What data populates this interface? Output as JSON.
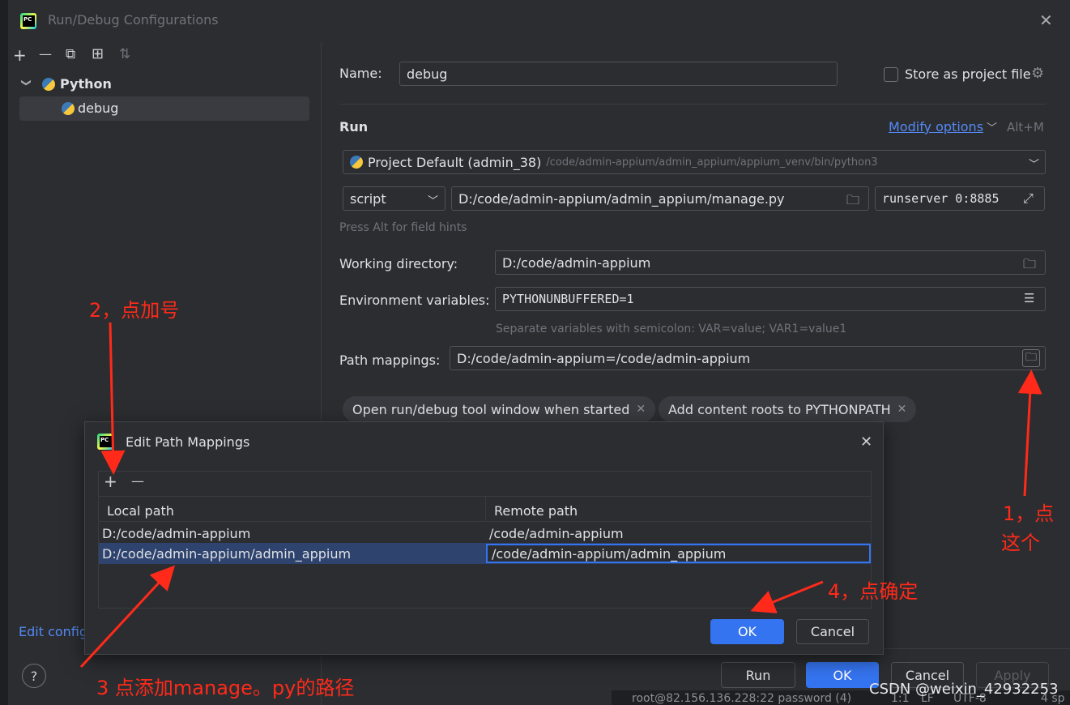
{
  "window": {
    "title": "Run/Debug Configurations"
  },
  "toolbar": {
    "add": "+",
    "remove": "—",
    "copy": "⧉",
    "folder": "⊞",
    "sort": "⇅"
  },
  "tree": {
    "group_label": "Python",
    "item_label": "debug",
    "chevron": "❯"
  },
  "left_footer": {
    "edit_config_link": "Edit config"
  },
  "form": {
    "name_label": "Name:",
    "name_value": "debug",
    "store_label": "Store as project file",
    "run_heading": "Run",
    "modify_options": "Modify options",
    "modify_shortcut": "Alt+M",
    "interpreter_name": "Project Default (admin_38)",
    "interpreter_path": "/code/admin-appium/admin_appium/appium_venv/bin/python3",
    "script_type": "script",
    "script_path": "D:/code/admin-appium/admin_appium/manage.py",
    "params": "runserver 0:8885",
    "field_hint": "Press Alt for field hints",
    "workdir_label": "Working directory:",
    "workdir_value": "D:/code/admin-appium",
    "env_label": "Environment variables:",
    "env_value": "PYTHONUNBUFFERED=1",
    "env_hint": "Separate variables with semicolon: VAR=value; VAR1=value1",
    "path_map_label": "Path mappings:",
    "path_map_value": "D:/code/admin-appium=/code/admin-appium",
    "chip1": "Open run/debug tool window when started",
    "chip2": "Add content roots to PYTHONPATH"
  },
  "footer": {
    "run": "Run",
    "ok": "OK",
    "cancel": "Cancel",
    "apply": "Apply"
  },
  "dialog": {
    "title": "Edit Path Mappings",
    "add": "+",
    "remove": "—",
    "col_local": "Local path",
    "col_remote": "Remote path",
    "rows": [
      {
        "local": "D:/code/admin-appium",
        "remote": "/code/admin-appium"
      },
      {
        "local": "D:/code/admin-appium/admin_appium",
        "remote": "/code/admin-appium/admin_appium"
      }
    ],
    "ok": "OK",
    "cancel": "Cancel"
  },
  "annotations": {
    "step1a": "1，点",
    "step1b": "这个",
    "step2": "2，点加号",
    "step3": "3 点添加manage。py的路径",
    "step4": "4，点确定"
  },
  "status_bar": {
    "ssh": "root@82.156.136.228:22 password (4)",
    "pos": "1:1",
    "lf": "LF",
    "enc": "UTF-8",
    "indent": "4 sp",
    "watermark": "CSDN @weixin_42932253"
  },
  "colors": {
    "accent": "#3574f0",
    "annotation": "#ff2a1a",
    "selection": "#2e436e"
  }
}
